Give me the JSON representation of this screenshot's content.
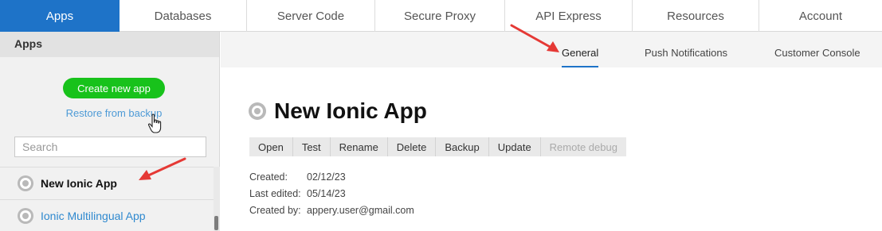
{
  "topnav": {
    "tabs": [
      {
        "label": "Apps",
        "active": true
      },
      {
        "label": "Databases"
      },
      {
        "label": "Server Code"
      },
      {
        "label": "Secure Proxy"
      },
      {
        "label": "API Express"
      },
      {
        "label": "Resources"
      },
      {
        "label": "Account"
      }
    ]
  },
  "sidebar": {
    "header": "Apps",
    "create_button": "Create new app",
    "restore_link": "Restore from backup",
    "search_placeholder": "Search",
    "apps": [
      {
        "name": "New Ionic App",
        "icon": "ionic-ring-icon",
        "selected": true
      },
      {
        "name": "Ionic Multilingual App",
        "icon": "ionic-ring-icon"
      }
    ]
  },
  "main": {
    "subtabs": [
      {
        "label": "General",
        "active": true
      },
      {
        "label": "Push Notifications"
      },
      {
        "label": "Customer Console"
      }
    ],
    "app_title": "New Ionic App",
    "actions": [
      {
        "label": "Open"
      },
      {
        "label": "Test"
      },
      {
        "label": "Rename"
      },
      {
        "label": "Delete"
      },
      {
        "label": "Backup"
      },
      {
        "label": "Update"
      },
      {
        "label": "Remote debug",
        "disabled": true
      }
    ],
    "meta": {
      "created_label": "Created:",
      "created_value": "02/12/23",
      "edited_label": "Last edited:",
      "edited_value": "05/14/23",
      "by_label": "Created by:",
      "by_value": "appery.user@gmail.com"
    }
  },
  "colors": {
    "accent": "#1e73c8",
    "create_button": "#18c21b",
    "link": "#2f89cf",
    "annotation_arrow": "#e53935"
  }
}
